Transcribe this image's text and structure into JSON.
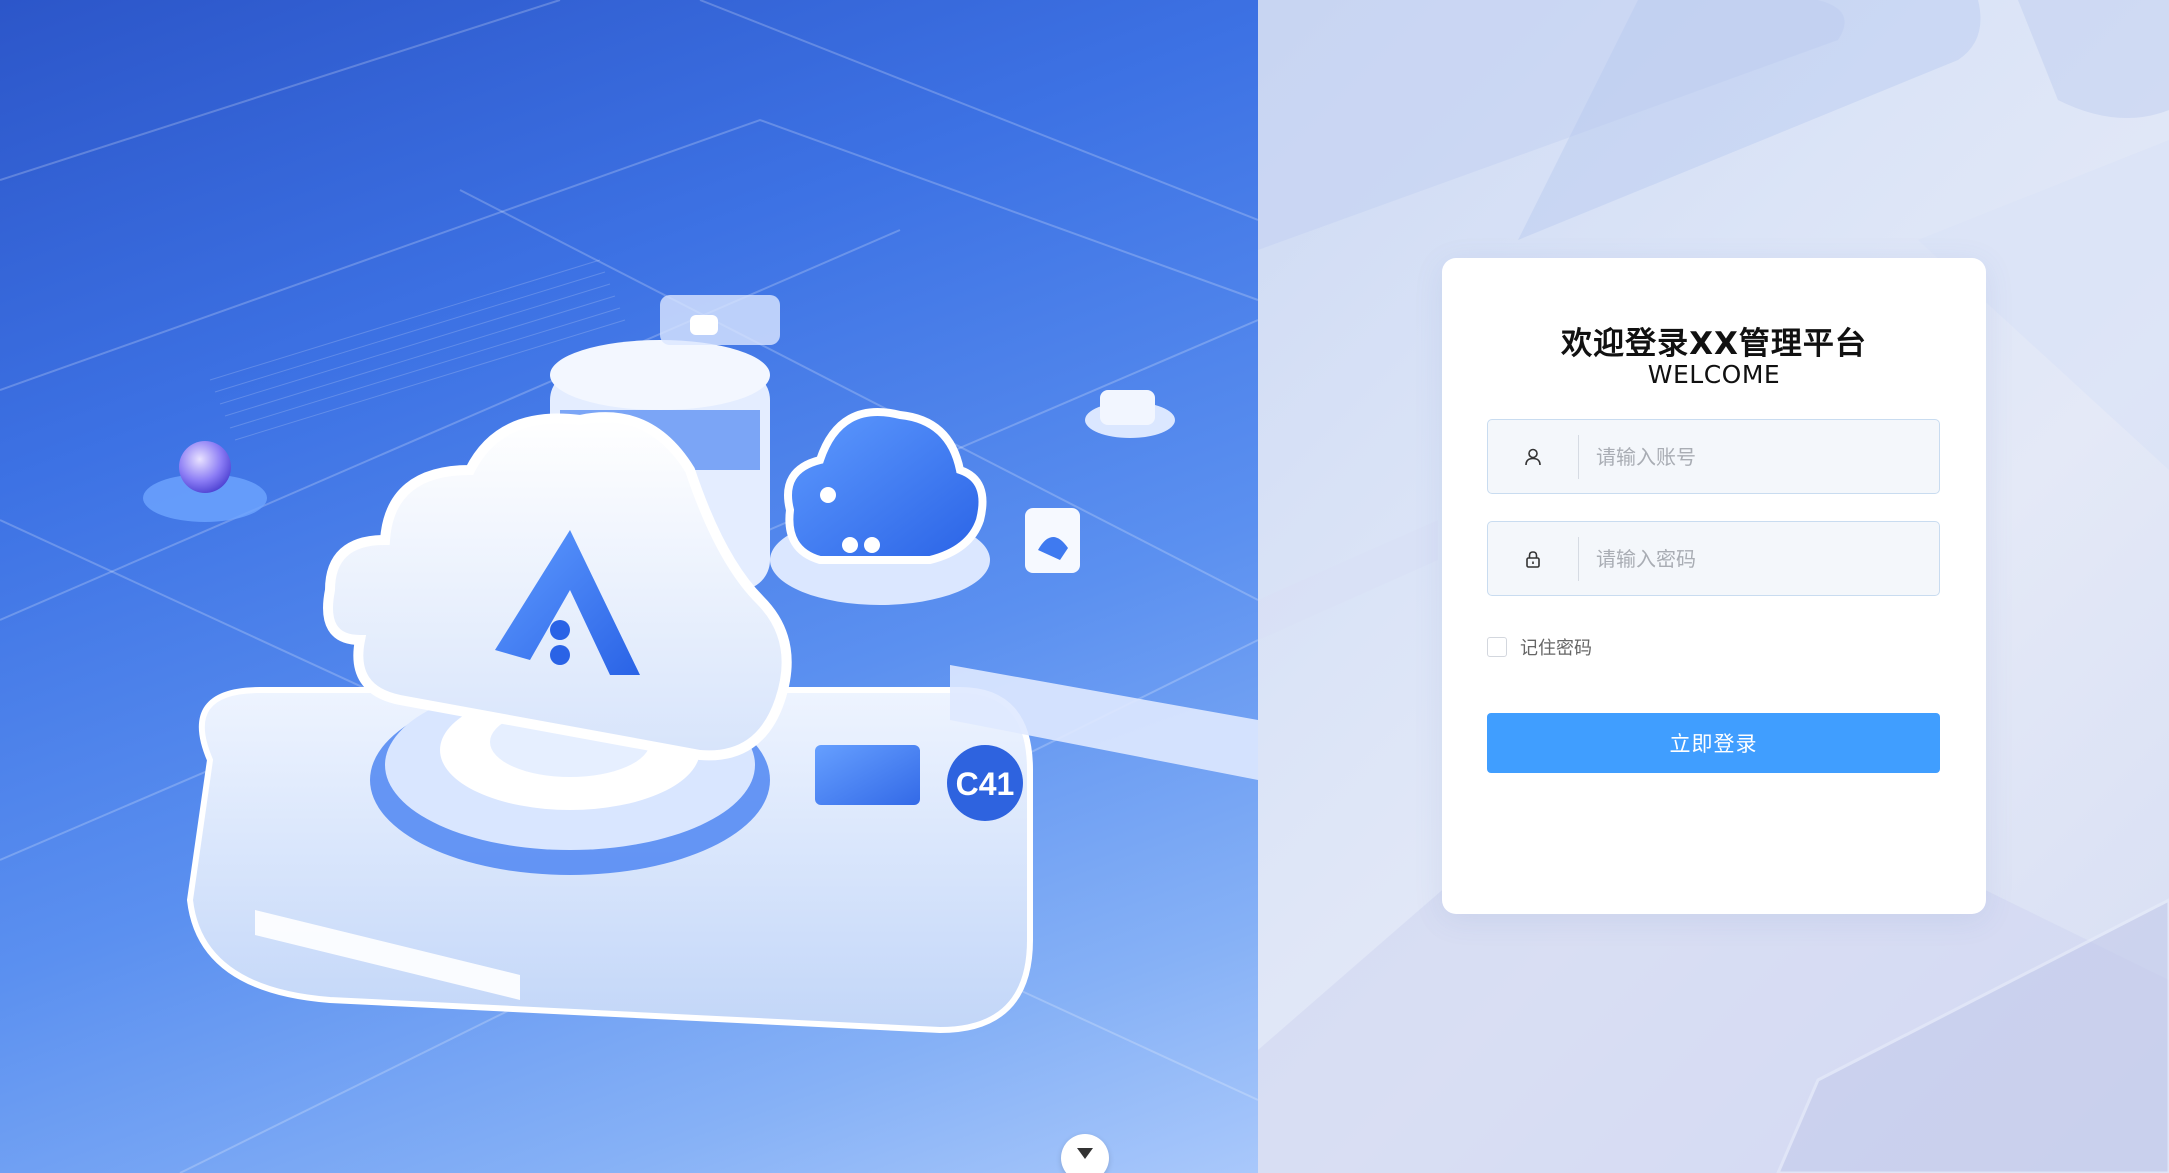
{
  "login": {
    "title": "欢迎登录XX管理平台",
    "subtitle": "WELCOME",
    "username_placeholder": "请输入账号",
    "password_placeholder": "请输入密码",
    "remember_label": "记住密码",
    "submit_label": "立即登录"
  },
  "icons": {
    "username": "user-icon",
    "password": "lock-icon",
    "scroll": "chevron-down-icon"
  },
  "colors": {
    "primary": "#409eff",
    "field_bg": "#f4f7fb",
    "field_border": "#c9dcf0",
    "card_bg": "#ffffff"
  }
}
